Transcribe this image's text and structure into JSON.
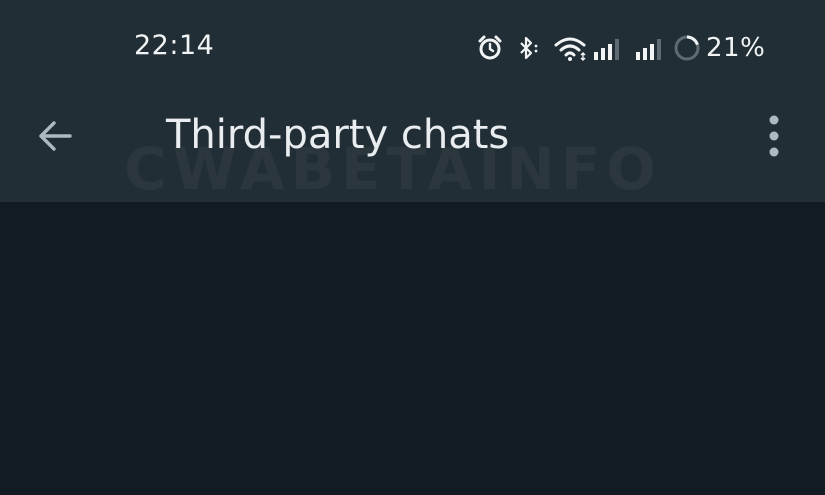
{
  "status_bar": {
    "time": "22:14",
    "battery": "21%",
    "icons": [
      "alarm-icon",
      "bluetooth-icon",
      "wifi-icon",
      "signal-icon",
      "signal-icon",
      "battery-ring-icon"
    ]
  },
  "toolbar": {
    "title": "Third-party chats",
    "back_icon": "arrow-back-icon",
    "menu_icon": "more-vert-icon"
  },
  "watermark": "CWABETAINFO",
  "colors": {
    "app_bar": "#222e35",
    "background": "#121b22",
    "text": "#e9edef",
    "icon": "#aebac1"
  }
}
